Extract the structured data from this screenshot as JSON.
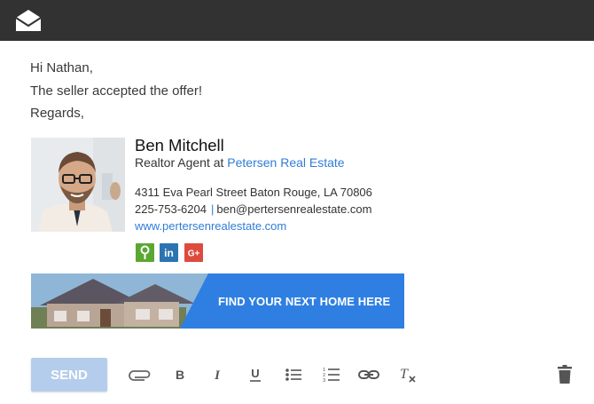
{
  "header": {
    "icon": "open-envelope-icon"
  },
  "message": {
    "greeting": "Hi Nathan,",
    "body": "The seller accepted the offer!",
    "closing": "Regards,"
  },
  "signature": {
    "name": "Ben Mitchell",
    "role_prefix": "Realtor Agent at ",
    "company": "Petersen Real Estate",
    "address": "4311 Eva Pearl Street Baton Rouge, LA 70806",
    "phone": "225-753-6204",
    "separator": "|",
    "email": "ben@pertersenrealestate.com",
    "website": "www.pertersenrealestate.com",
    "social": [
      {
        "icon": "map-pin-icon",
        "color": "#5aa832"
      },
      {
        "icon": "linkedin-icon",
        "label": "in",
        "color": "#2b74b1"
      },
      {
        "icon": "google-plus-icon",
        "label": "G+",
        "color": "#dd4b3e"
      }
    ],
    "banner_text": "FIND YOUR NEXT HOME HERE"
  },
  "toolbar": {
    "send_label": "SEND",
    "tools": [
      "attach-icon",
      "bold-icon",
      "italic-icon",
      "underline-icon",
      "bulleted-list-icon",
      "numbered-list-icon",
      "link-icon",
      "clear-formatting-icon",
      "trash-icon"
    ]
  },
  "colors": {
    "topbar": "#323232",
    "link": "#2f7dd7",
    "banner": "#2f7fe2",
    "send_disabled": "#b5cdec"
  }
}
